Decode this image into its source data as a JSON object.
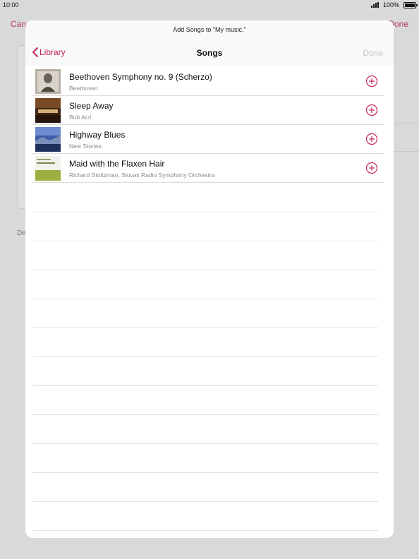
{
  "status_bar": {
    "time": "10:00",
    "battery": "100%"
  },
  "background": {
    "left_label": "Can",
    "right_label": "Done",
    "detail_text": "De"
  },
  "modal": {
    "prompt": "Add Songs to \"My music.\"",
    "back_label": "Library",
    "title": "Songs",
    "done_label": "Done",
    "accent_color": "#c2255c",
    "songs": [
      {
        "title": "Beethoven Symphony no. 9 (Scherzo)",
        "artist": "Beethoven",
        "art_icon": "beethoven-portrait"
      },
      {
        "title": "Sleep Away",
        "artist": "Bob Acri",
        "art_icon": "piano-photo"
      },
      {
        "title": "Highway Blues",
        "artist": "New Stories",
        "art_icon": "landscape-photo"
      },
      {
        "title": "Maid with the Flaxen Hair",
        "artist": "Richard Stoltzman, Slovak Radio Symphony Orchestra",
        "art_icon": "stoltzman-cover"
      }
    ]
  }
}
